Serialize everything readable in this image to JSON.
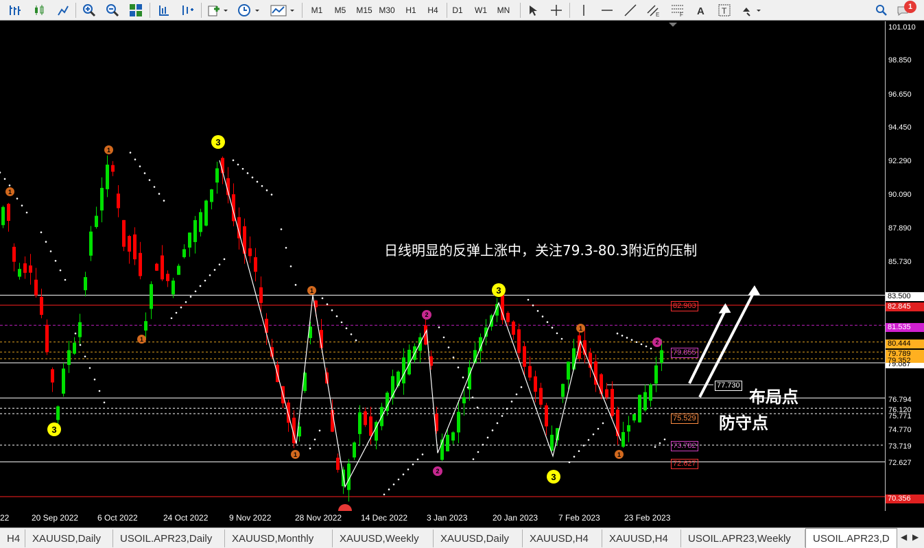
{
  "toolbar": {
    "timeframes": [
      "M1",
      "M5",
      "M15",
      "M30",
      "H1",
      "H4",
      "D1",
      "W1",
      "MN"
    ],
    "notification_count": "1"
  },
  "chart": {
    "annotation_text": "日线明显的反弹上涨中，关注79.3-80.3附近的压制",
    "label_layout": "布局点",
    "label_defense": "防守点",
    "level_box_77730": "77.730",
    "inline_levels": {
      "l82903": "82.903",
      "l79855": "79.855",
      "l75529": "75.529",
      "l73782": "73.782",
      "l72627": "72.627"
    },
    "markers": {
      "three": "3",
      "one": "1",
      "two": "2"
    }
  },
  "price_axis": {
    "ticks": [
      "101.010",
      "98.850",
      "96.650",
      "94.450",
      "92.290",
      "90.090",
      "87.890",
      "85.730",
      "74.770",
      "73.719",
      "72.627"
    ],
    "boxes": {
      "b83500": "83.500",
      "b82845": "82.845",
      "b81535": "81.535",
      "b80444": "80.444",
      "b79789": "79.789",
      "b79352": "79.352",
      "b79087": "79.087",
      "b76794": "76.794",
      "b76120": "76.120",
      "b75771": "75.771",
      "b70356": "70.356"
    }
  },
  "time_axis": {
    "labels": [
      "22",
      "20 Sep 2022",
      "6 Oct 2022",
      "24 Oct 2022",
      "9 Nov 2022",
      "28 Nov 2022",
      "14 Dec 2022",
      "3 Jan 2023",
      "20 Jan 2023",
      "7 Feb 2023",
      "23 Feb 2023"
    ]
  },
  "tabs": [
    "H4",
    "XAUUSD,Daily",
    "USOIL.APR23,Daily",
    "XAUUSD,Monthly",
    "XAUUSD,Weekly",
    "XAUUSD,Daily",
    "XAUUSD,H4",
    "XAUUSD,H4",
    "USOIL.APR23,Weekly",
    "USOIL.APR23,D"
  ],
  "colors": {
    "bull": "#00e000",
    "bear": "#ff0000",
    "resistance": "#ff0000",
    "magenta": "#c000c0",
    "orange": "#ff8c00"
  }
}
